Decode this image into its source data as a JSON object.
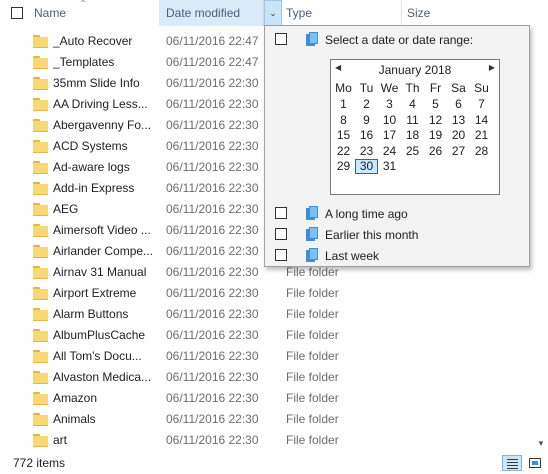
{
  "header": {
    "name": "Name",
    "date_modified": "Date modified",
    "type": "Type",
    "size": "Size"
  },
  "files": [
    {
      "name": "_Auto Recover",
      "date": "06/11/2016 22:47",
      "type": ""
    },
    {
      "name": "_Templates",
      "date": "06/11/2016 22:47",
      "type": ""
    },
    {
      "name": "35mm Slide Info",
      "date": "06/11/2016 22:30",
      "type": ""
    },
    {
      "name": "AA  Driving Less...",
      "date": "06/11/2016 22:30",
      "type": ""
    },
    {
      "name": "Abergavenny Fo...",
      "date": "06/11/2016 22:30",
      "type": ""
    },
    {
      "name": "ACD Systems",
      "date": "06/11/2016 22:30",
      "type": ""
    },
    {
      "name": "Ad-aware logs",
      "date": "06/11/2016 22:30",
      "type": ""
    },
    {
      "name": "Add-in Express",
      "date": "06/11/2016 22:30",
      "type": ""
    },
    {
      "name": "AEG",
      "date": "06/11/2016 22:30",
      "type": ""
    },
    {
      "name": "Aimersoft Video ...",
      "date": "06/11/2016 22:30",
      "type": ""
    },
    {
      "name": "Airlander Compe...",
      "date": "06/11/2016 22:30",
      "type": ""
    },
    {
      "name": "Airnav 31 Manual",
      "date": "06/11/2016 22:30",
      "type": "File folder"
    },
    {
      "name": "Airport Extreme",
      "date": "06/11/2016 22:30",
      "type": "File folder"
    },
    {
      "name": "Alarm Buttons",
      "date": "06/11/2016 22:30",
      "type": "File folder"
    },
    {
      "name": "AlbumPlusCache",
      "date": "06/11/2016 22:30",
      "type": "File folder"
    },
    {
      "name": "All Tom's Docu...",
      "date": "06/11/2016 22:30",
      "type": "File folder"
    },
    {
      "name": "Alvaston Medica...",
      "date": "06/11/2016 22:30",
      "type": "File folder"
    },
    {
      "name": "Amazon",
      "date": "06/11/2016 22:30",
      "type": "File folder"
    },
    {
      "name": "Animals",
      "date": "06/11/2016 22:30",
      "type": "File folder"
    },
    {
      "name": "art",
      "date": "06/11/2016 22:30",
      "type": "File folder"
    }
  ],
  "filter": {
    "range_label": "Select a date or date range:",
    "options": [
      "A long time ago",
      "Earlier this month",
      "Last week"
    ]
  },
  "calendar": {
    "month_title": "January 2018",
    "weekdays": [
      "Mo",
      "Tu",
      "We",
      "Th",
      "Fr",
      "Sa",
      "Su"
    ],
    "weeks": [
      [
        "",
        "1",
        "2",
        "3",
        "4",
        "5",
        "6",
        "7"
      ],
      [
        "8",
        "9",
        "10",
        "11",
        "12",
        "13",
        "14"
      ],
      [
        "15",
        "16",
        "17",
        "18",
        "19",
        "20",
        "21"
      ],
      [
        "22",
        "23",
        "24",
        "25",
        "26",
        "27",
        "28"
      ],
      [
        "29",
        "30",
        "31",
        "",
        "",
        "",
        ""
      ]
    ],
    "selected_day": "30",
    "prev_icon": "triangle-left-icon",
    "next_icon": "triangle-right-icon"
  },
  "status": {
    "item_count": "772 items"
  },
  "colors": {
    "header_highlight": "#d9ebf9",
    "selection": "#cce8ff",
    "folder": "#f8d775",
    "accent": "#3b8fd9"
  }
}
